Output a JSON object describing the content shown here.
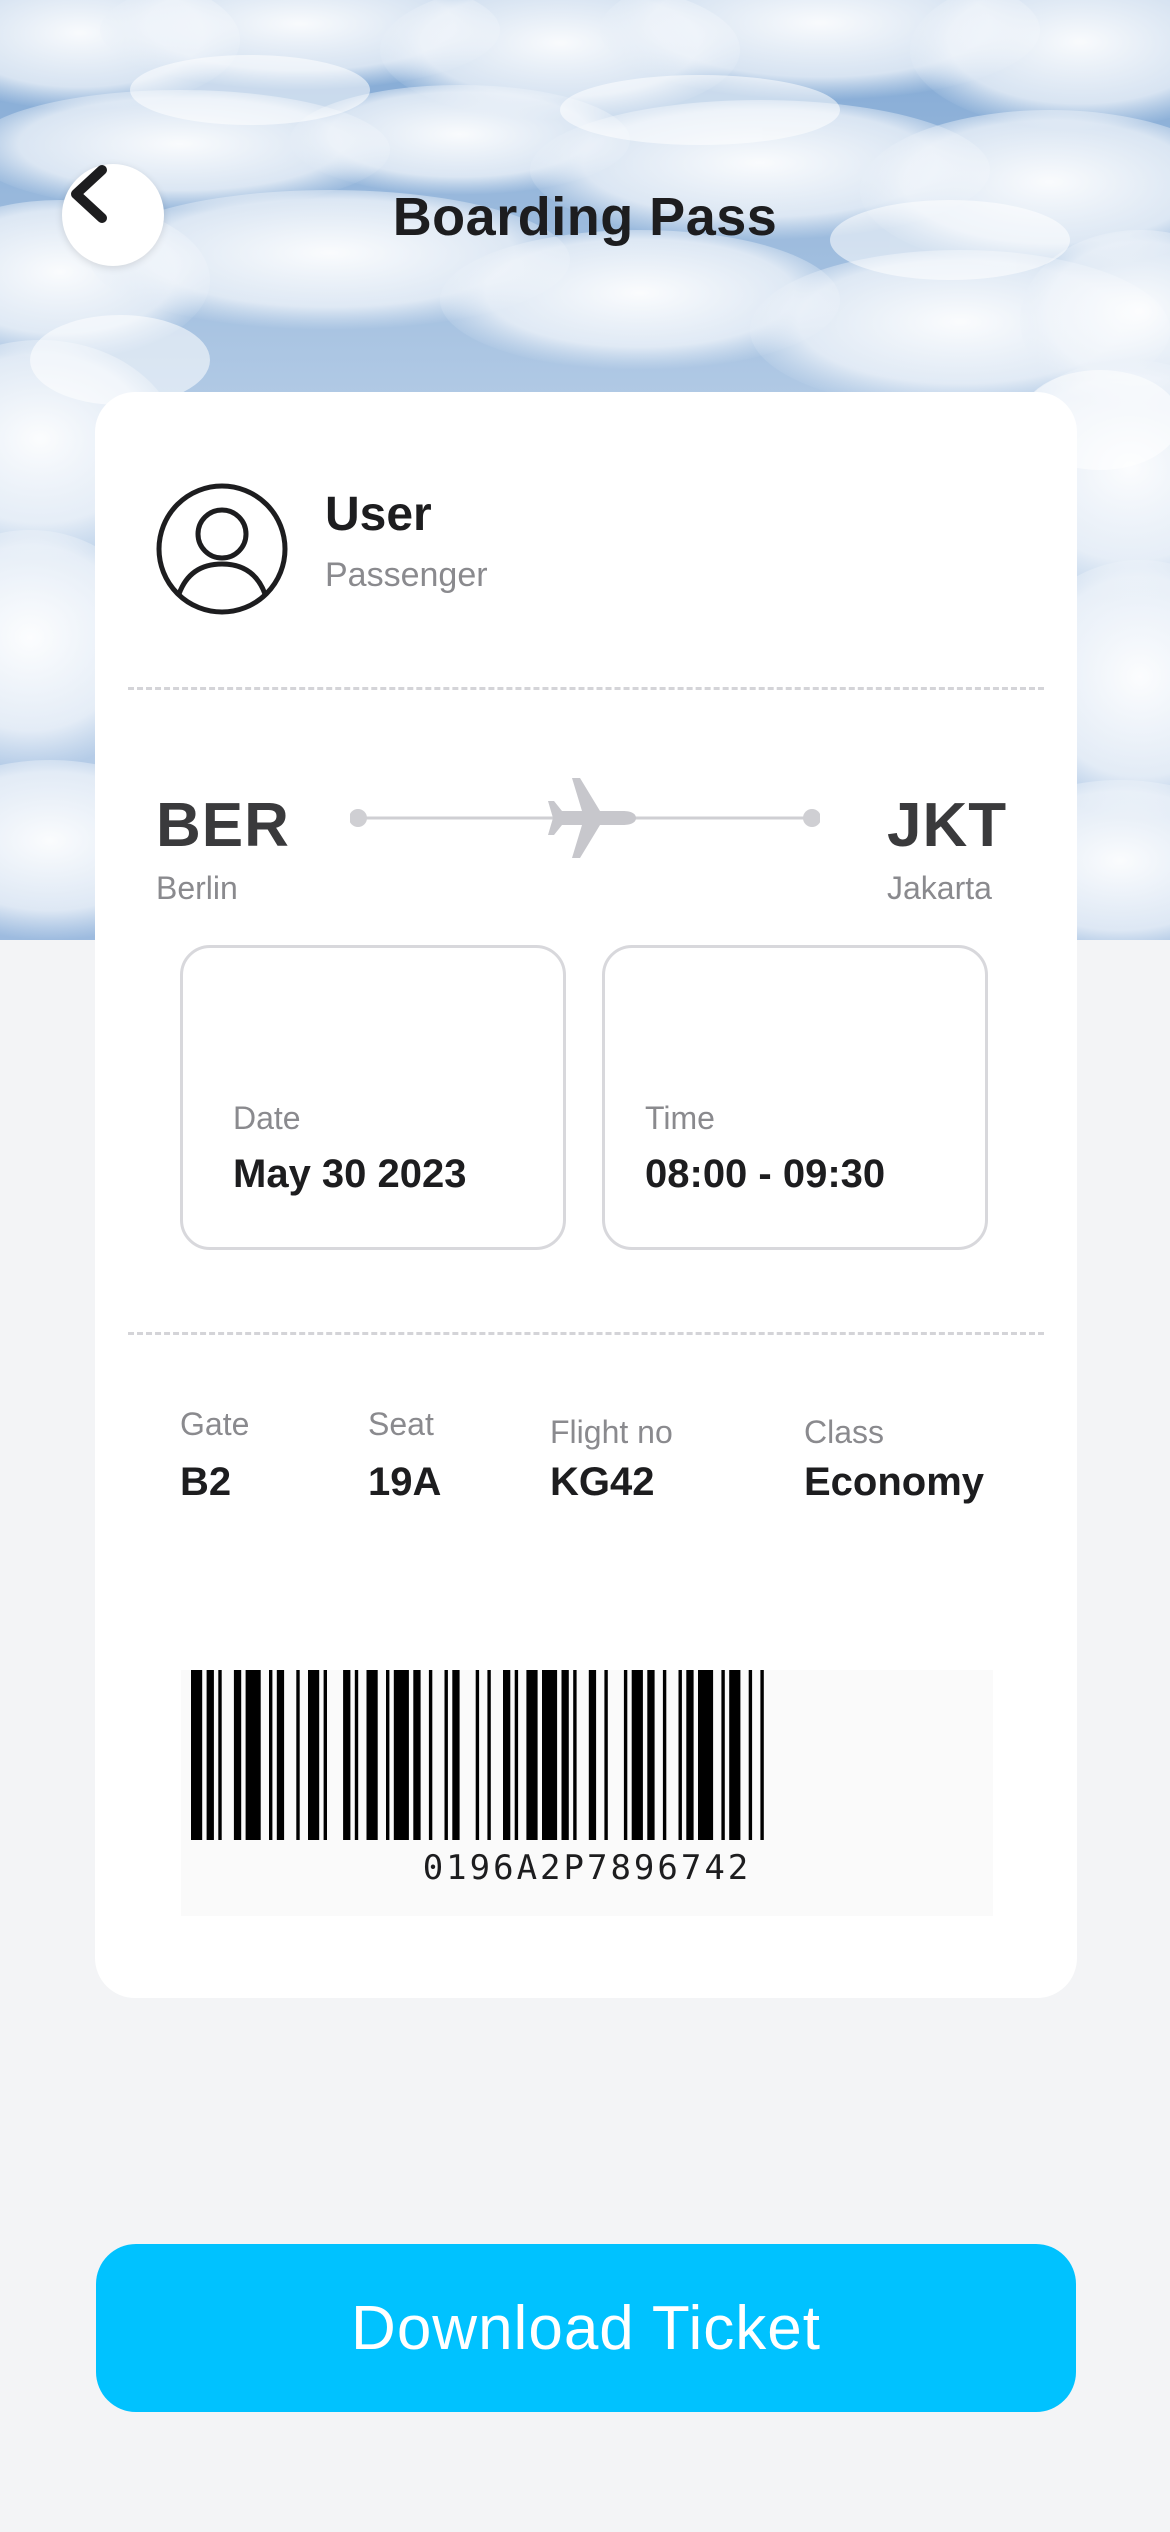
{
  "header": {
    "title": "Boarding Pass",
    "back_icon": "chevron-left-icon"
  },
  "passenger": {
    "name": "User",
    "role": "Passenger",
    "avatar_icon": "user-avatar-icon"
  },
  "route": {
    "from_code": "BER",
    "from_city": "Berlin",
    "to_code": "JKT",
    "to_city": "Jakarta",
    "plane_icon": "airplane-icon"
  },
  "schedule": {
    "date_label": "Date",
    "date_value": "May 30 2023",
    "time_label": "Time",
    "time_value": "08:00 - 09:30"
  },
  "details": {
    "gate_label": "Gate",
    "gate_value": "B2",
    "seat_label": "Seat",
    "seat_value": "19A",
    "flight_label": "Flight no",
    "flight_value": "KG42",
    "class_label": "Class",
    "class_value": "Economy"
  },
  "barcode": {
    "number": "0196A2P7896742"
  },
  "actions": {
    "download_label": "Download Ticket"
  },
  "colors": {
    "accent": "#00c2ff",
    "card": "#ffffff",
    "background": "#f3f4f6"
  }
}
